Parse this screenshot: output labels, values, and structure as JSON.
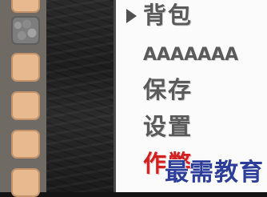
{
  "menu": {
    "items": [
      {
        "label": "背包",
        "selected": true
      },
      {
        "label": "AAAAAAA"
      },
      {
        "label": "保存"
      },
      {
        "label": "设置"
      },
      {
        "label": "作弊"
      }
    ]
  },
  "watermark": "最需教育",
  "colors": {
    "menu_text": "#5a5a5a",
    "danger_text": "#d02020",
    "panel_bg": "#fbfbfb",
    "slot_bg": "#e8b98e"
  }
}
